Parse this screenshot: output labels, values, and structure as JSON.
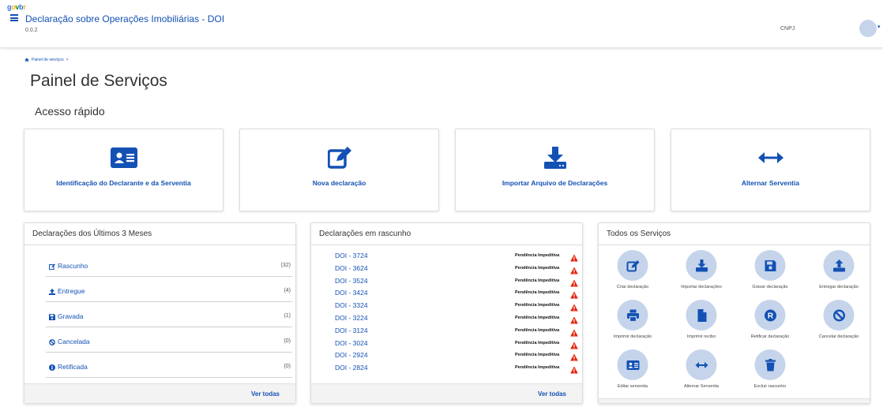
{
  "header": {
    "logo": {
      "g": "g",
      "o": "o",
      "v": "v",
      "b": "b",
      "r": "r"
    },
    "title": "Declaração sobre Operações Imobiliárias - DOI",
    "version": "0.0.2",
    "cnpj_label": "CNPJ",
    "avatar_chevron": "▾"
  },
  "breadcrumb": {
    "home_icon": "home-icon",
    "item": "Painel de serviços",
    "separator": ">"
  },
  "page_title": "Painel de Serviços",
  "quick_access": {
    "title": "Acesso rápido",
    "cards": [
      {
        "label": "Identificação do Declarante e da Serventia",
        "icon": "id-card-icon"
      },
      {
        "label": "Nova declaração",
        "icon": "edit-icon"
      },
      {
        "label": "Importar Arquivo de Declarações",
        "icon": "download-icon"
      },
      {
        "label": "Alternar Serventia",
        "icon": "arrows-horizontal-icon"
      }
    ]
  },
  "recent": {
    "title": "Declarações dos Últimos 3 Meses",
    "rows": [
      {
        "label": "Rascunho",
        "count": "(32)",
        "icon": "edit-icon"
      },
      {
        "label": "Entregue",
        "count": "(4)",
        "icon": "upload-icon"
      },
      {
        "label": "Gravada",
        "count": "(1)",
        "icon": "save-icon"
      },
      {
        "label": "Cancelada",
        "count": "(0)",
        "icon": "ban-icon"
      },
      {
        "label": "Retificada",
        "count": "(0)",
        "icon": "info-circle-icon"
      }
    ],
    "view_all": "Ver todas"
  },
  "drafts": {
    "title": "Declarações em rascunho",
    "rows": [
      {
        "name": "DOI - 3724",
        "status": "Pendência Impeditiva"
      },
      {
        "name": "DOI - 3624",
        "status": "Pendência Impeditiva"
      },
      {
        "name": "DOI - 3524",
        "status": "Pendência Impeditiva"
      },
      {
        "name": "DOI - 3424",
        "status": "Pendência Impeditiva"
      },
      {
        "name": "DOI - 3324",
        "status": "Pendência Impeditiva"
      },
      {
        "name": "DOI - 3224",
        "status": "Pendência Impeditiva"
      },
      {
        "name": "DOI - 3124",
        "status": "Pendência Impeditiva"
      },
      {
        "name": "DOI - 3024",
        "status": "Pendência Impeditiva"
      },
      {
        "name": "DOI - 2924",
        "status": "Pendência Impeditiva"
      },
      {
        "name": "DOI - 2824",
        "status": "Pendência Impeditiva"
      }
    ],
    "view_all": "Ver todas"
  },
  "services": {
    "title": "Todos os Serviços",
    "items": [
      {
        "label": "Criar declaração",
        "icon": "edit-icon"
      },
      {
        "label": "Importar declarações",
        "icon": "download-icon"
      },
      {
        "label": "Gravar declaração",
        "icon": "save-icon"
      },
      {
        "label": "Entregar declaração",
        "icon": "upload-icon"
      },
      {
        "label": "Imprimir declaração",
        "icon": "print-icon"
      },
      {
        "label": "Imprimir recibo",
        "icon": "file-icon"
      },
      {
        "label": "Retificar declaração",
        "icon": "r-circle-icon",
        "glyph": "R"
      },
      {
        "label": "Cancelar declaração",
        "icon": "ban-icon"
      },
      {
        "label": "Editar serventia",
        "icon": "id-card-icon"
      },
      {
        "label": "Alternar Serventia",
        "icon": "arrows-horizontal-icon"
      },
      {
        "label": "Excluir rascunho",
        "icon": "trash-icon"
      }
    ]
  },
  "colors": {
    "primary": "#1351b4",
    "icon_bg": "#c5d4eb",
    "warning": "#e52207"
  }
}
